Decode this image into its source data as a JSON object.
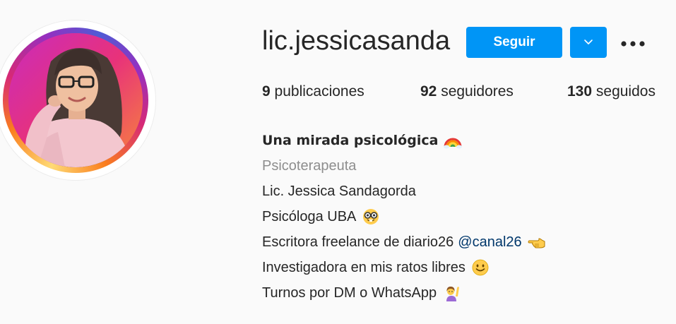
{
  "profile": {
    "username": "lic.jessicasanda",
    "follow_label": "Seguir",
    "stats": {
      "posts_count": "9",
      "posts_label": "publicaciones",
      "followers_count": "92",
      "followers_label": "seguidores",
      "following_count": "130",
      "following_label": "seguidos"
    },
    "bio": {
      "full_name": "Una mirada psicológica",
      "category": "Psicoterapeuta",
      "line1": "Lic. Jessica Sandagorda",
      "line2": "Psicóloga UBA",
      "line3": "Escritora freelance de diario26",
      "mention": "@canal26",
      "line4": "Investigadora en mis ratos libres",
      "line5": "Turnos por DM o WhatsApp"
    }
  },
  "icons": {
    "dropdown": "chevron-down-icon",
    "more": "more-options-icon",
    "rainbow": "rainbow-emoji",
    "nerd": "nerd-face-emoji",
    "pointing": "backhand-index-pointing-left-emoji",
    "smile": "slightly-smiling-face-emoji",
    "raising_hand": "person-raising-hand-emoji"
  },
  "colors": {
    "accent": "#0095f6",
    "text": "#262626",
    "secondary_text": "#8e8e8e",
    "mention": "#00376b",
    "background": "#fafafa"
  }
}
